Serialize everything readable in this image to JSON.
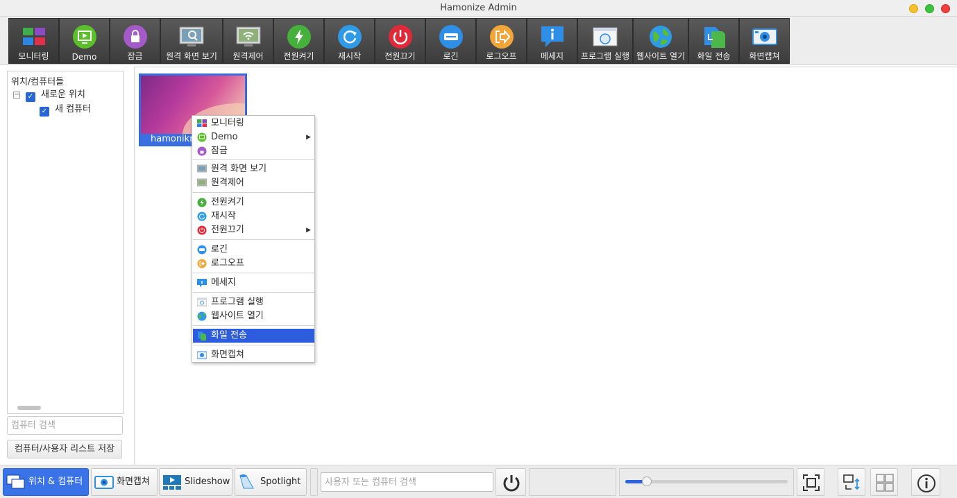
{
  "window": {
    "title": "Hamonize Admin"
  },
  "toolbar": {
    "buttons": [
      {
        "label": "모니터링",
        "icon": "monitoring-grid-icon"
      },
      {
        "label": "Demo",
        "icon": "demo-icon"
      },
      {
        "label": "잠금",
        "icon": "lock-icon"
      },
      {
        "label": "원격 화면 보기",
        "icon": "remote-view-icon"
      },
      {
        "label": "원격제어",
        "icon": "remote-control-icon"
      },
      {
        "label": "전원켜기",
        "icon": "power-on-icon"
      },
      {
        "label": "재시작",
        "icon": "restart-icon"
      },
      {
        "label": "전원끄기",
        "icon": "power-off-icon"
      },
      {
        "label": "로긴",
        "icon": "login-icon"
      },
      {
        "label": "로그오프",
        "icon": "logoff-icon"
      },
      {
        "label": "메세지",
        "icon": "message-icon"
      },
      {
        "label": "프로그램 실행",
        "icon": "run-program-icon"
      },
      {
        "label": "웹사이트 열기",
        "icon": "open-website-icon"
      },
      {
        "label": "화일 전송",
        "icon": "file-transfer-icon"
      },
      {
        "label": "화면캡쳐",
        "icon": "screen-capture-icon"
      }
    ]
  },
  "tree": {
    "title": "위치/컴퓨터들",
    "location": "새로운 위치",
    "computer": "새 컴퓨터"
  },
  "left": {
    "search_placeholder": "컴퓨터 검색",
    "save_button": "컴퓨터/사용자 리스트 저장"
  },
  "computer_tile": {
    "name": "hamonikr"
  },
  "context_menu": {
    "items": [
      {
        "label": "모니터링",
        "icon": "monitoring-grid-icon"
      },
      {
        "label": "Demo",
        "icon": "demo-icon",
        "submenu": true
      },
      {
        "label": "잠금",
        "icon": "lock-icon"
      },
      {
        "label": "원격 화면 보기",
        "icon": "remote-view-icon"
      },
      {
        "label": "원격제어",
        "icon": "remote-control-icon"
      },
      {
        "label": "전원켜기",
        "icon": "power-on-icon"
      },
      {
        "label": "재시작",
        "icon": "restart-icon"
      },
      {
        "label": "전원끄기",
        "icon": "power-off-icon",
        "submenu": true
      },
      {
        "label": "로긴",
        "icon": "login-icon"
      },
      {
        "label": "로그오프",
        "icon": "logoff-icon"
      },
      {
        "label": "메세지",
        "icon": "message-icon"
      },
      {
        "label": "프로그램 실행",
        "icon": "run-program-icon"
      },
      {
        "label": "웹사이트 열기",
        "icon": "open-website-icon"
      },
      {
        "label": "화일 전송",
        "icon": "file-transfer-icon",
        "highlighted": true
      },
      {
        "label": "화면캡쳐",
        "icon": "screen-capture-icon"
      }
    ]
  },
  "statusbar": {
    "tabs": [
      {
        "label": "위치 & 컴퓨터",
        "icon": "locations-computers-icon",
        "active": true
      },
      {
        "label": "화면캡쳐",
        "icon": "screenshot-tab-icon"
      },
      {
        "label": "Slideshow",
        "icon": "slideshow-icon"
      },
      {
        "label": "Spotlight",
        "icon": "spotlight-icon"
      }
    ],
    "search_placeholder": "사용자 또는 컴퓨터 검색",
    "zoom_level": 0.12
  },
  "colors": {
    "accent": "#2d5cde",
    "toolbar_button": "#464646",
    "selection": "#3a73e8"
  }
}
